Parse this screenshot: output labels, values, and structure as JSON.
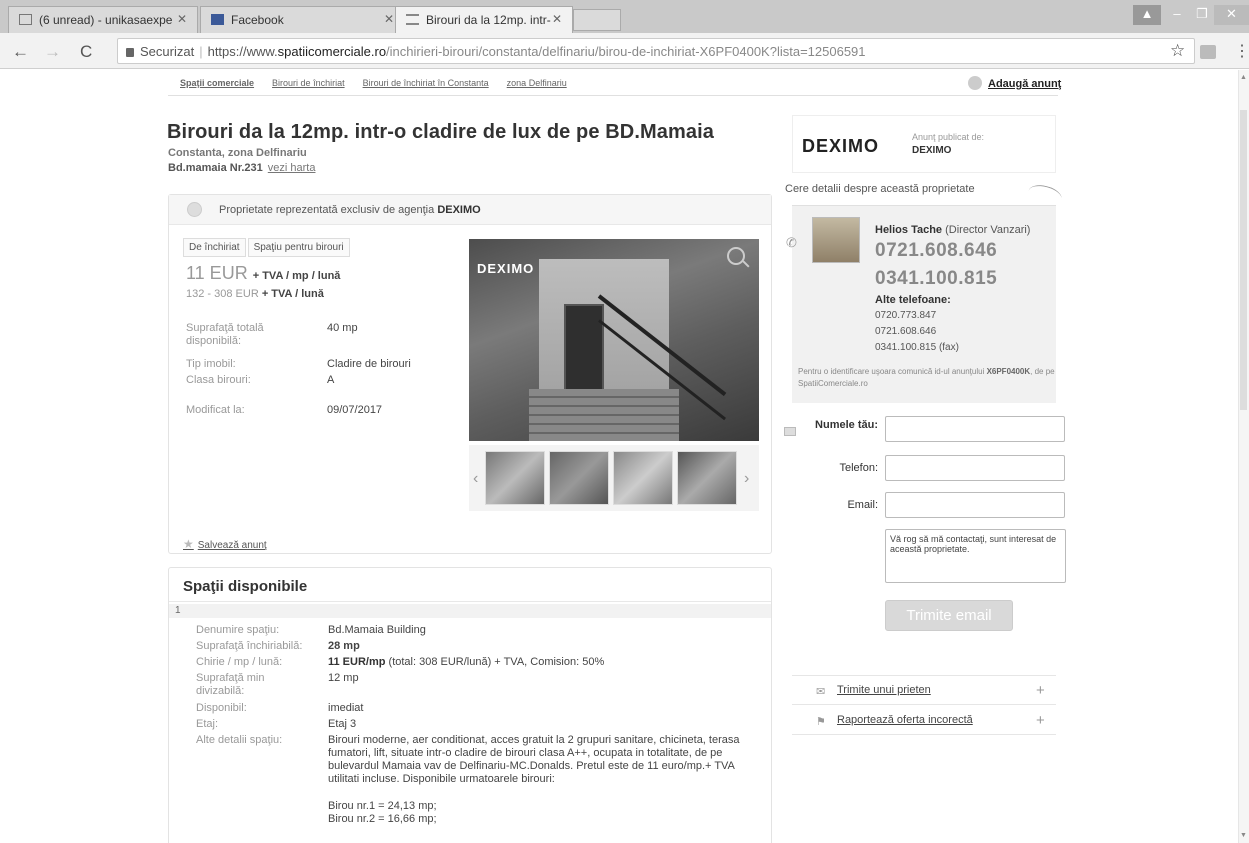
{
  "browser": {
    "tabs": [
      {
        "label": "(6 unread) - unikasaexpe",
        "icon": "mail-icon"
      },
      {
        "label": "Facebook",
        "icon": "facebook-icon"
      },
      {
        "label": "Birouri da la 12mp. intr-",
        "icon": "site-icon"
      }
    ],
    "url_secure": "Securizat",
    "url_scheme": "https://www.",
    "url_domain": "spatiicomerciale.ro",
    "url_path": "/inchirieri-birouri/constanta/delfinariu/birou-de-inchiriat-X6PF0400K?lista=12506591"
  },
  "breadcrumbs": [
    "Spaţii comerciale",
    "Birouri de închiriat",
    "Birouri de închiriat în Constanta",
    "zona Delfinariu"
  ],
  "add_ad_label": "Adaugă anunţ",
  "listing": {
    "title": "Birouri da la 12mp. intr-o cladire de lux de pe BD.Mamaia",
    "location": "Constanta, zona Delfinariu",
    "address": "Bd.mamaia Nr.231",
    "map_link": "vezi harta",
    "exclusive_prefix": "Proprietate reprezentată exclusiv de agenţia ",
    "exclusive_agency": "DEXIMO",
    "tags": [
      "De închiriat",
      "Spaţiu pentru birouri"
    ],
    "price_main": "11 EUR",
    "price_main_suffix": "+ TVA / mp / lună",
    "price_range": "132 - 308 EUR",
    "price_range_suffix": "+ TVA / lună",
    "attributes": [
      {
        "label": "Suprafaţă totală disponibilă:",
        "value": "40 mp"
      },
      {
        "label": "Tip imobil:",
        "value": "Cladire de birouri"
      },
      {
        "label": "Clasa birouri:",
        "value": "A"
      },
      {
        "label": "Modificat la:",
        "value": "09/07/2017"
      }
    ],
    "photo_logo": "DEXIMO",
    "save_label": "Salvează anunţ"
  },
  "available": {
    "title": "Spaţii disponibile",
    "index": "1",
    "rows": [
      {
        "label": "Denumire spaţiu:",
        "value": "Bd.Mamaia Building"
      },
      {
        "label": "Suprafaţă închiriabilă:",
        "value": "28 mp"
      },
      {
        "label": "Chirie / mp / lună:",
        "value_bold": "11 EUR/mp",
        "value": " (total: 308 EUR/lună) + TVA, Comision: 50%"
      },
      {
        "label": "Suprafaţă min divizabilă:",
        "value": "12 mp"
      },
      {
        "label": "Disponibil:",
        "value": "imediat"
      },
      {
        "label": "Etaj:",
        "value": "Etaj 3"
      },
      {
        "label": "Alte detalii spaţiu:",
        "value": "Birouri moderne, aer conditionat, acces gratuit la 2 grupuri sanitare, chicineta, terasa fumatori, lift, situate intr-o cladire de birouri clasa A++, ocupata in totalitate, de pe bulevardul Mamaia vav de Delfinariu-MC.Donalds. Pretul este de 11 euro/mp.+ TVA utilitati incluse. Disponibile urmatoarele birouri:"
      },
      {
        "label": "",
        "value": "Birou nr.1 = 24,13 mp;"
      },
      {
        "label": "",
        "value": "Birou nr.2 = 16,66 mp;"
      }
    ]
  },
  "agency": {
    "logo": "DEXIMO",
    "published_by": "Anunţ publicat de:",
    "name": "DEXIMO"
  },
  "contact": {
    "ask_details": "Cere detalii despre această proprietate",
    "agent_name": "Helios Tache",
    "agent_role": " (Director Vanzari)",
    "phone1": "0721.608.646",
    "phone2": "0341.100.815",
    "other_label": "Alte telefoane:",
    "other_phones": [
      "0720.773.847",
      "0721.608.646",
      "0341.100.815 (fax)"
    ],
    "id_note_prefix": "Pentru o identificare uşoara comunică id-ul anunţului ",
    "id_note_code": "X6PF0400K",
    "id_note_suffix": ", de pe SpatiiComerciale.ro",
    "form": {
      "name_label": "Numele tău:",
      "phone_label": "Telefon:",
      "email_label": "Email:",
      "message": "Vă rog să mă contactaţi, sunt interesat de această proprietate.",
      "send_label": "Trimite email"
    }
  },
  "actions": [
    {
      "label": "Trimite unui prieten",
      "icon": "envelope-icon"
    },
    {
      "label": "Raportează oferta incorectă",
      "icon": "flag-icon"
    }
  ]
}
